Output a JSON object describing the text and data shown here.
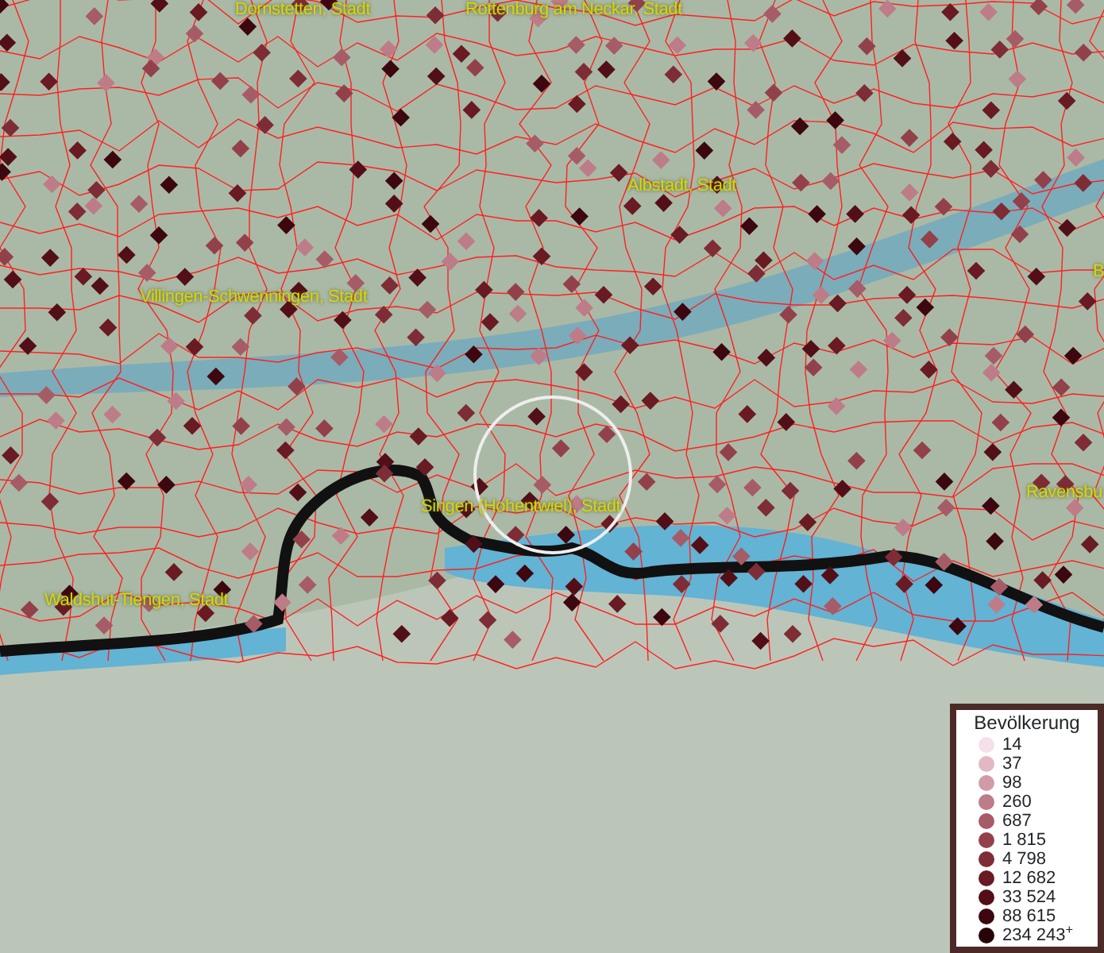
{
  "map": {
    "place_labels": [
      {
        "text": "Dornstetten, Stadt"
      },
      {
        "text": "Rottenburg am Neckar, Stadt"
      },
      {
        "text": "Albstadt, Stadt"
      },
      {
        "text": "B"
      },
      {
        "text": "Villingen-Schwenningen, Stadt"
      },
      {
        "text": "Singen (Hohentwiel), Stadt"
      },
      {
        "text": "Ravensbu"
      },
      {
        "text": "Waldshut-Tiengen, Stadt"
      }
    ]
  },
  "legend": {
    "title": "Bevölkerung",
    "items": [
      {
        "label": "14",
        "color": "#f5dfe8"
      },
      {
        "label": "37",
        "color": "#e2b8c4"
      },
      {
        "label": "98",
        "color": "#d09ba7"
      },
      {
        "label": "260",
        "color": "#bd7c88"
      },
      {
        "label": "687",
        "color": "#a65c67"
      },
      {
        "label": "1 815",
        "color": "#92414b"
      },
      {
        "label": "4 798",
        "color": "#7e2c36"
      },
      {
        "label": "12 682",
        "color": "#691a23"
      },
      {
        "label": "33 524",
        "color": "#530f18"
      },
      {
        "label": "88 615",
        "color": "#3d0710"
      },
      {
        "label": "234 243$^{+}$",
        "color": "#280307"
      }
    ]
  }
}
